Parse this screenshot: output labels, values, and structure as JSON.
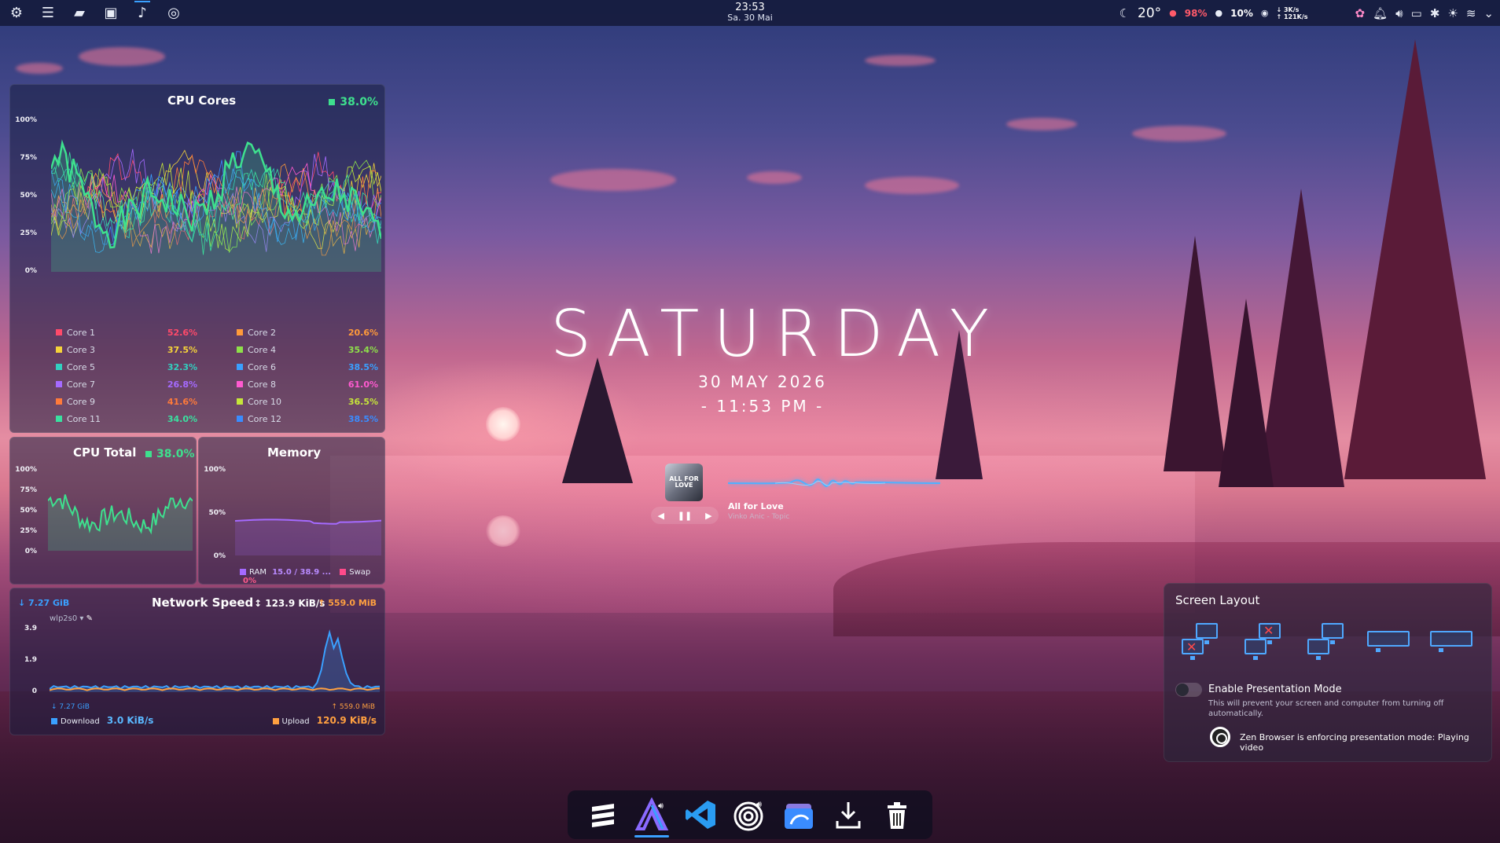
{
  "top_panel": {
    "left_icons": [
      "settings-icon",
      "control-panel-icon",
      "file-manager-icon",
      "terminal-icon",
      "app-with-audio-icon",
      "zen-browser-icon"
    ],
    "clock_time": "23:53",
    "clock_date": "Sa. 30 Mai",
    "weather_temp": "20°",
    "cpu_stat": "98%",
    "other_stat": "10%",
    "net_down": "↓ 3K/s",
    "net_up": "↑ 121K/s"
  },
  "cpu_cores": {
    "title": "CPU Cores",
    "total": "38.0%",
    "y_ticks": [
      "100%",
      "75%",
      "50%",
      "25%",
      "0%"
    ],
    "cores": [
      {
        "name": "Core 1",
        "value": "52.6%",
        "color": "#ff4a6a"
      },
      {
        "name": "Core 2",
        "value": "20.6%",
        "color": "#ff9a3a"
      },
      {
        "name": "Core 3",
        "value": "37.5%",
        "color": "#f5d33a"
      },
      {
        "name": "Core 4",
        "value": "35.4%",
        "color": "#8ee04a"
      },
      {
        "name": "Core 5",
        "value": "32.3%",
        "color": "#32d0c0"
      },
      {
        "name": "Core 6",
        "value": "38.5%",
        "color": "#3aa0ff"
      },
      {
        "name": "Core 7",
        "value": "26.8%",
        "color": "#a56aff"
      },
      {
        "name": "Core 8",
        "value": "61.0%",
        "color": "#ff5ad0"
      },
      {
        "name": "Core 9",
        "value": "41.6%",
        "color": "#ff7a3a"
      },
      {
        "name": "Core 10",
        "value": "36.5%",
        "color": "#c6e63a"
      },
      {
        "name": "Core 11",
        "value": "34.0%",
        "color": "#3ae0a0"
      },
      {
        "name": "Core 12",
        "value": "38.5%",
        "color": "#3a8cff"
      }
    ]
  },
  "cpu_total": {
    "title": "CPU Total",
    "value": "38.0%",
    "y_ticks": [
      "100%",
      "75%",
      "50%",
      "25%",
      "0%"
    ]
  },
  "memory": {
    "title": "Memory",
    "y_ticks": [
      "100%",
      "50%",
      "0%"
    ],
    "ram_label": "RAM",
    "ram_value": "15.0 / 38.9 ...",
    "swap_label": "Swap",
    "swap_value": "0%"
  },
  "network": {
    "title": "Network Speed",
    "total_down": "↓ 7.27 GiB",
    "interface": "wlp2s0 ▾",
    "speed": "↕ 123.9 KiB/s",
    "total_up": "↑ 559.0 MiB",
    "y_ticks": [
      "3.9",
      "1.9",
      "0"
    ],
    "y_unit": "MiB/s",
    "sub_down": "↓ 7.27 GiB",
    "sub_up": "↑ 559.0 MiB",
    "download_label": "Download",
    "download_value": "3.0 KiB/s",
    "upload_label": "Upload",
    "upload_value": "120.9 KiB/s"
  },
  "center": {
    "day": "SATURDAY",
    "date": "30 MAY 2026",
    "time": "- 11:53 PM -"
  },
  "media": {
    "cover_text": "ALL FOR LOVE",
    "title": "All for Love",
    "artist": "Vinko Anic - Topic",
    "prev": "◀",
    "pause": "❚❚",
    "next": "▶"
  },
  "screen_layout": {
    "title": "Screen Layout",
    "presentation_label": "Enable Presentation Mode",
    "presentation_desc": "This will prevent your screen and computer from turning off automatically.",
    "zen_notice": "Zen Browser is enforcing presentation mode: Playing video"
  },
  "dock": [
    "app-launcher-icon",
    "arch-app-icon",
    "vscode-icon",
    "zen-browser-icon",
    "dolphin-file-manager-icon",
    "download-icon",
    "trash-icon"
  ]
}
